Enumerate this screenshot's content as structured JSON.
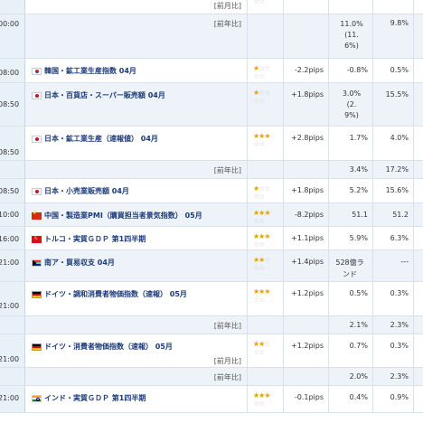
{
  "labels": {
    "prev_year": "[前年比]",
    "prev_month": "[前月比]"
  },
  "rows": [
    {
      "kind": "cont",
      "time": "",
      "prev_label": "[前月比]",
      "pips": "",
      "prev": "",
      "forecast": "",
      "stars": 0
    },
    {
      "kind": "sub",
      "time": "00:00",
      "prev_label": "[前年比]",
      "pips": "",
      "prev": "11.0%\n(11.\n6%)",
      "forecast": "9.8%"
    },
    {
      "kind": "main",
      "time": "08:00",
      "flag": "kr",
      "name": "韓国・鉱工業生産指数 04月",
      "stars": 1,
      "pips": "-2.2pips",
      "prev": "-0.8%",
      "forecast": "0.5%"
    },
    {
      "kind": "main",
      "time": "08:50",
      "flag": "jp",
      "name": "日本・百貨店・スーパー販売額 04月",
      "stars": 1,
      "pips": "+1.8pips",
      "prev": "3.0%\n(2.\n9%)",
      "forecast": "15.5%"
    },
    {
      "kind": "main",
      "time": "08:50",
      "flag": "jp",
      "name": "日本・鉱工業生産（速報値） 04月",
      "stars": 3,
      "pips": "+2.8pips",
      "prev": "1.7%",
      "forecast": "4.0%"
    },
    {
      "kind": "sub",
      "time": "",
      "prev_label": "[前年比]",
      "pips": "",
      "prev": "3.4%",
      "forecast": "17.2%"
    },
    {
      "kind": "main",
      "time": "08:50",
      "flag": "jp",
      "name": "日本・小売業販売額 04月",
      "stars": 1,
      "pips": "+1.8pips",
      "prev": "5.2%",
      "forecast": "15.6%"
    },
    {
      "kind": "main",
      "time": "10:00",
      "flag": "cn",
      "name": "中国・製造業PMI（購買担当者景気指数） 05月",
      "stars": 3,
      "pips": "-8.2pips",
      "prev": "51.1",
      "forecast": "51.2"
    },
    {
      "kind": "main",
      "time": "16:00",
      "flag": "tr",
      "name": "トルコ・実質ＧＤＰ 第1四半期",
      "stars": 3,
      "pips": "+1.1pips",
      "prev": "5.9%",
      "forecast": "6.3%"
    },
    {
      "kind": "main",
      "time": "21:00",
      "flag": "za",
      "name": "南ア・貿易収支 04月",
      "stars": 2,
      "pips": "+1.4pips",
      "prev": "528億ラ\nンド",
      "forecast": "---"
    },
    {
      "kind": "main",
      "time": "21:00",
      "flag": "de",
      "name": "ドイツ・調和消費者物価指数（速報） 05月",
      "stars": 3,
      "pips": "+1.2pips",
      "prev": "0.5%",
      "forecast": "0.3%"
    },
    {
      "kind": "sub",
      "time": "",
      "prev_label": "[前年比]",
      "pips": "",
      "prev": "2.1%",
      "forecast": "2.3%"
    },
    {
      "kind": "main",
      "time": "21:00",
      "flag": "de",
      "name": "ドイツ・消費者物価指数（速報） 05月",
      "stars": 2,
      "pips": "+1.2pips",
      "prev": "0.7%",
      "forecast": "0.3%"
    },
    {
      "kind": "sub",
      "time": "",
      "prev_label": "[前年比]",
      "pips": "",
      "prev": "2.0%",
      "forecast": "2.3%"
    },
    {
      "kind": "main",
      "time": "21:00",
      "flag": "in",
      "name": "インド・実質ＧＤＰ 第1四半期",
      "stars": 3,
      "pips": "-0.1pips",
      "prev": "0.4%",
      "forecast": "0.9%"
    }
  ]
}
